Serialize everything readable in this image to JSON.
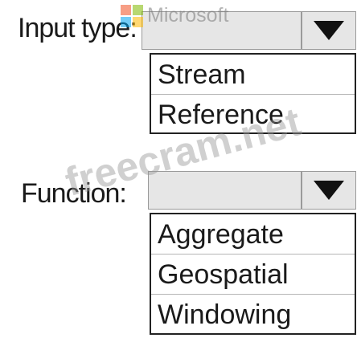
{
  "input_type": {
    "label": "Input type:",
    "options": [
      "Stream",
      "Reference"
    ]
  },
  "function": {
    "label": "Function:",
    "options": [
      "Aggregate",
      "Geospatial",
      "Windowing"
    ]
  },
  "logo": {
    "text": "Microsoft",
    "colors": [
      "#f25022",
      "#7fba00",
      "#00a4ef",
      "#ffb900"
    ]
  },
  "watermark": "freecram.net",
  "icons": {
    "dropdown": "triangle-down-icon"
  }
}
